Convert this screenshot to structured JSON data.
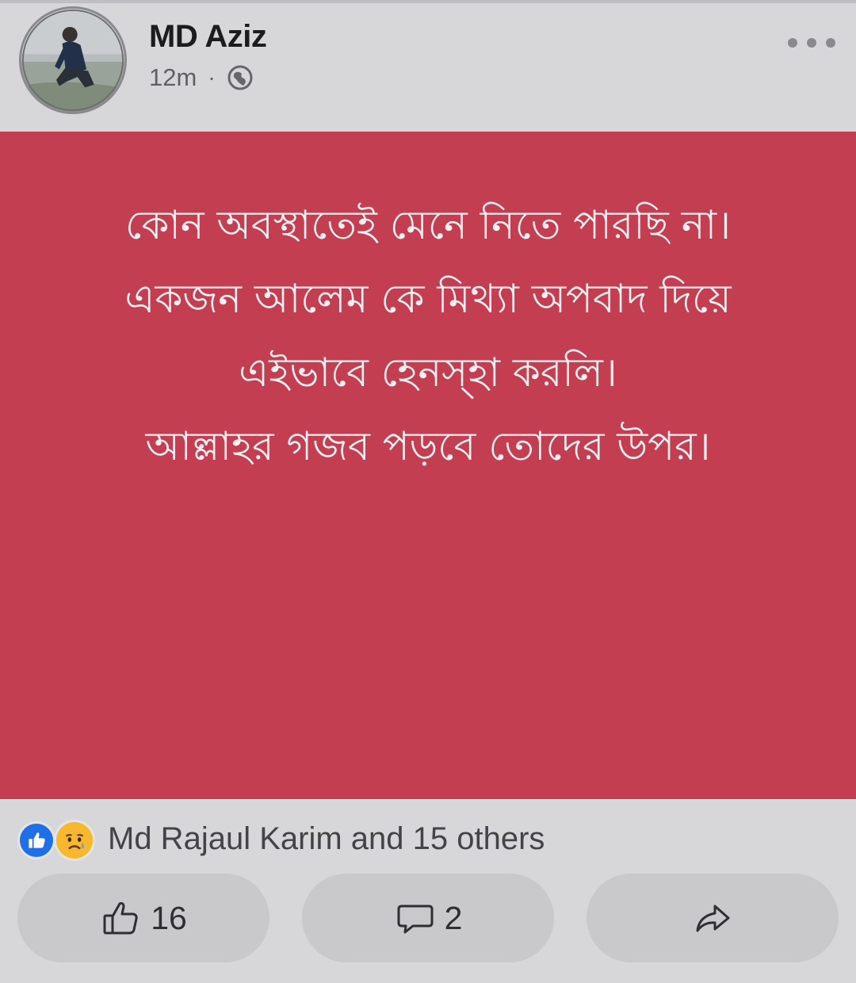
{
  "post": {
    "author_name": "MD Aziz",
    "time": "12m",
    "separator": "·",
    "privacy_icon": "globe-icon",
    "more_icon": "more-dots-icon",
    "background_color": "#c33e50",
    "text_lines": [
      "কোন অবস্থাতেই মেনে নিতে পারছি না।",
      "একজন আলেম কে মিথ্যা অপবাদ দিয়ে",
      "এইভাবে হেনস্হা করলি।",
      "আল্লাহর গজব পড়বে তোদের উপর।"
    ]
  },
  "reactions": {
    "icons": [
      "like-reaction-icon",
      "sad-reaction-icon"
    ],
    "summary": "Md Rajaul Karim and 15 others"
  },
  "actions": {
    "like_count": "16",
    "comment_count": "2",
    "like_icon": "thumbs-up-icon",
    "comment_icon": "comment-icon",
    "share_icon": "share-icon"
  }
}
